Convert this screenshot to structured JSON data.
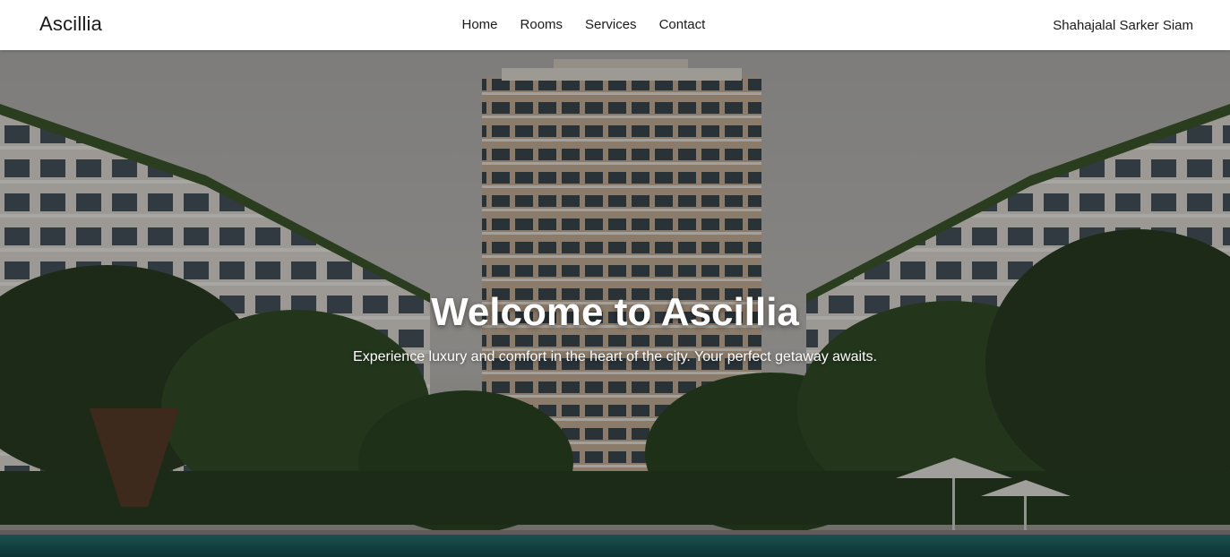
{
  "navbar": {
    "brand": "Ascillia",
    "links": [
      "Home",
      "Rooms",
      "Services",
      "Contact"
    ],
    "user_name": "Shahajalal Sarker Siam"
  },
  "hero": {
    "title": "Welcome to Ascillia",
    "subtitle": "Experience luxury and comfort in the heart of the city. Your perfect getaway awaits.",
    "background_image": "hotel-resort-photo"
  },
  "colors": {
    "navbar_bg": "#ffffff",
    "text_dark": "#1a1a1a",
    "hero_text": "#ffffff",
    "pool_water": "#1f6b6a",
    "foliage": "#2f4a24"
  }
}
